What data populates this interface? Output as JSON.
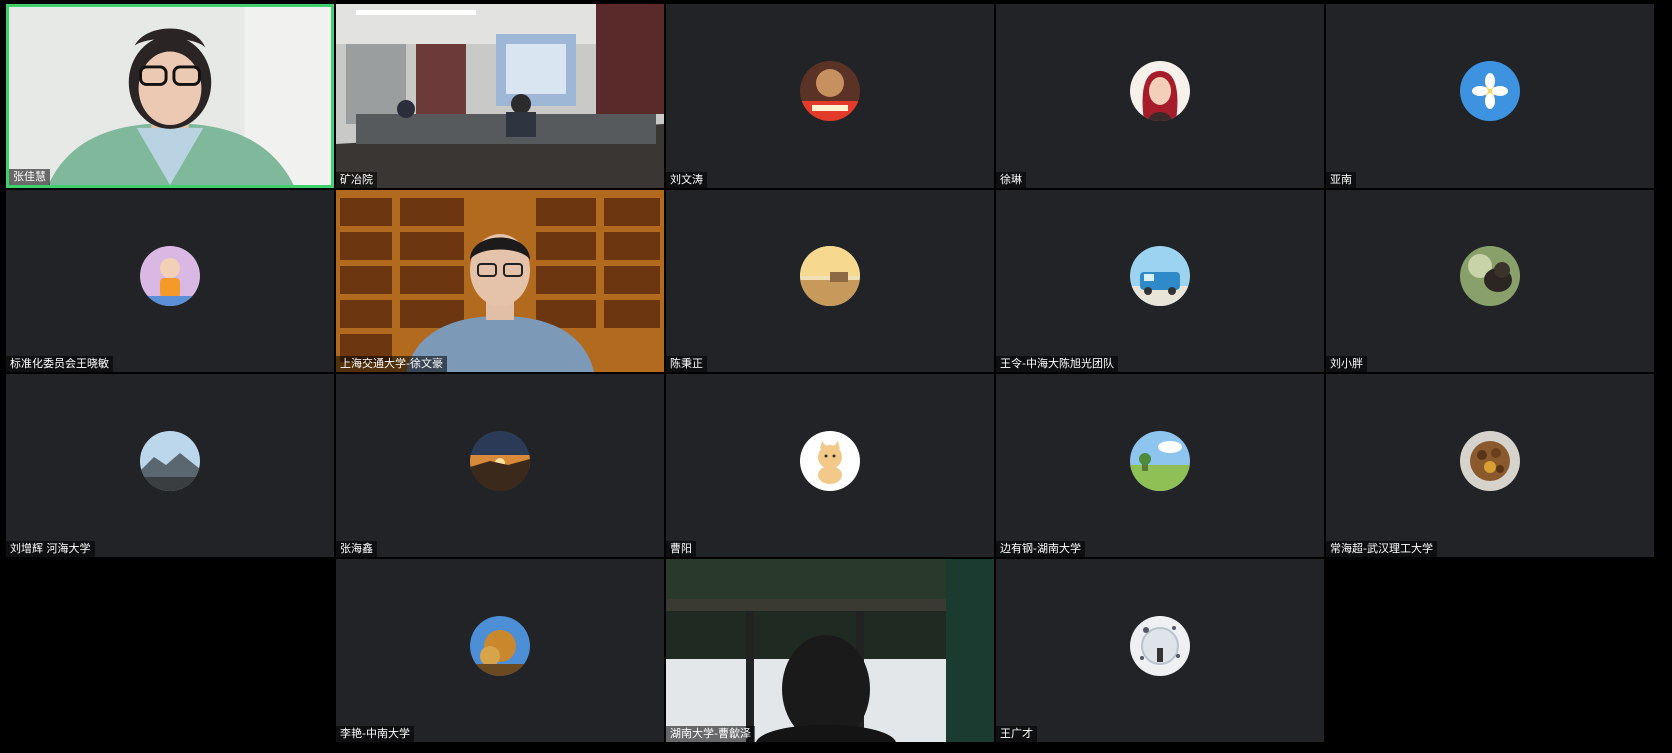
{
  "meeting": {
    "participants": [
      {
        "name": "张佳慧",
        "type": "video",
        "avatar_icon": "woman-with-glasses-video",
        "speaking": true
      },
      {
        "name": "矿冶院",
        "type": "video",
        "avatar_icon": "conference-room-video"
      },
      {
        "name": "刘文涛",
        "type": "avatar",
        "avatar_icon": "profile-photo-icon"
      },
      {
        "name": "徐琳",
        "type": "avatar",
        "avatar_icon": "cartoon-girl-avatar-icon"
      },
      {
        "name": "亚南",
        "type": "avatar",
        "avatar_icon": "flower-sky-avatar-icon"
      },
      {
        "name": "标准化委员会王晓敏",
        "type": "avatar",
        "avatar_icon": "child-avatar-icon"
      },
      {
        "name": "上海交通大学-徐文豪",
        "type": "video",
        "avatar_icon": "man-bookshelf-video"
      },
      {
        "name": "陈秉正",
        "type": "avatar",
        "avatar_icon": "sunset-room-avatar-icon"
      },
      {
        "name": "王令-中海大陈旭光团队",
        "type": "avatar",
        "avatar_icon": "blue-van-avatar-icon"
      },
      {
        "name": "刘小胖",
        "type": "avatar",
        "avatar_icon": "dog-avatar-icon"
      },
      {
        "name": "刘增辉 河海大学",
        "type": "avatar",
        "avatar_icon": "mountain-avatar-icon"
      },
      {
        "name": "张海鑫",
        "type": "avatar",
        "avatar_icon": "sunset-avatar-icon"
      },
      {
        "name": "曹阳",
        "type": "avatar",
        "avatar_icon": "cartoon-cat-avatar-icon"
      },
      {
        "name": "边有钢-湖南大学",
        "type": "avatar",
        "avatar_icon": "meadow-avatar-icon"
      },
      {
        "name": "常海超-武汉理工大学",
        "type": "avatar",
        "avatar_icon": "food-avatar-icon"
      },
      {
        "name": "李艳-中南大学",
        "type": "avatar",
        "avatar_icon": "autumn-tree-avatar-icon"
      },
      {
        "name": "湖南大学-曹歙泽",
        "type": "video",
        "avatar_icon": "man-window-video"
      },
      {
        "name": "王广才",
        "type": "avatar",
        "avatar_icon": "bubble-avatar-icon"
      }
    ]
  }
}
